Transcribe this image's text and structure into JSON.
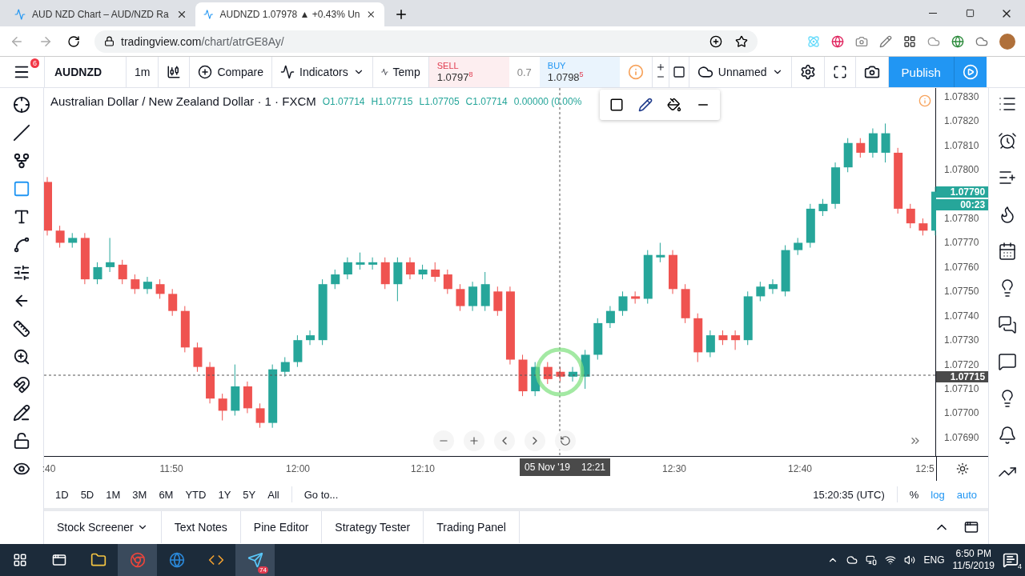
{
  "browser": {
    "tabs": [
      {
        "title": "AUD NZD Chart – AUD/NZD Ra",
        "selected": false
      },
      {
        "title": "AUDNZD 1.07978 ▲ +0.43% Un",
        "selected": true
      }
    ],
    "url": {
      "host": "tradingview.com",
      "path": "/chart/atrGE8Ay/"
    }
  },
  "toolbar": {
    "menu_badge": "6",
    "symbol": "AUDNZD",
    "interval": "1m",
    "compare": "Compare",
    "indicators": "Indicators",
    "templates": "Temp",
    "sell": {
      "label": "SELL",
      "price": "1.0797",
      "pip": "8"
    },
    "spread": "0.7",
    "buy": {
      "label": "BUY",
      "price": "1.0798",
      "pip": "5"
    },
    "layout": "Unnamed",
    "publish": "Publish"
  },
  "left_tools": [
    {
      "selected": false
    },
    {
      "selected": false
    },
    {
      "selected": false
    },
    {
      "selected": true
    },
    {
      "selected": false
    },
    {
      "selected": false
    },
    {
      "selected": false
    },
    {
      "selected": false
    },
    {
      "selected": false
    },
    {
      "selected": false
    },
    {
      "selected": false
    },
    {
      "selected": false
    },
    {
      "selected": false
    },
    {
      "selected": false
    }
  ],
  "legend": {
    "title": "Australian Dollar / New Zealand Dollar · 1 · FXCM",
    "values": [
      "O1.07714",
      "H1.07715",
      "L1.07705",
      "C1.07714",
      "0.00000 (0.00%"
    ]
  },
  "chart": {
    "chart_data": {
      "type": "candlestick",
      "categories": [
        null,
        null,
        null,
        null,
        null,
        null,
        null,
        null,
        null,
        null,
        null,
        null,
        null,
        null,
        null,
        null,
        null,
        null,
        null,
        null,
        null,
        null,
        null,
        null,
        null,
        null,
        null,
        null,
        null,
        null,
        null,
        null,
        null,
        null,
        null,
        null,
        null,
        null,
        null,
        null,
        null,
        null,
        null,
        null,
        null,
        null,
        null,
        null,
        null,
        null,
        null,
        null,
        null,
        null,
        null,
        null,
        null,
        null,
        null,
        null,
        null,
        null,
        null,
        null,
        null,
        null,
        null,
        null,
        null,
        null,
        null,
        null
      ],
      "ylim": [
        1.076824,
        1.078336
      ],
      "yticks": [
        {
          "value": 1.0783,
          "label": "1.07830"
        },
        {
          "value": 1.0782,
          "label": "1.07820"
        },
        {
          "value": 1.0781,
          "label": "1.07810"
        },
        {
          "value": 1.078,
          "label": "1.07800"
        },
        {
          "value": 1.0778,
          "label": "1.07780"
        },
        {
          "value": 1.0777,
          "label": "1.07770"
        },
        {
          "value": 1.0776,
          "label": "1.07760"
        },
        {
          "value": 1.0775,
          "label": "1.07750"
        },
        {
          "value": 1.0774,
          "label": "1.07740"
        },
        {
          "value": 1.0773,
          "label": "1.07730"
        },
        {
          "value": 1.0772,
          "label": "1.07720"
        },
        {
          "value": 1.0771,
          "label": "1.07710"
        },
        {
          "value": 1.077,
          "label": "1.07700"
        },
        {
          "value": 1.0769,
          "label": "1.07690"
        }
      ],
      "ohlc": [
        [
          1.07795,
          1.07797,
          1.07773,
          1.07775
        ],
        [
          1.07775,
          1.07777,
          1.07768,
          1.0777
        ],
        [
          1.0777,
          1.07774,
          1.07768,
          1.07772
        ],
        [
          1.07772,
          1.07774,
          1.07753,
          1.07755
        ],
        [
          1.07755,
          1.07762,
          1.07753,
          1.0776
        ],
        [
          1.0776,
          1.07772,
          1.07758,
          1.07762
        ],
        [
          1.07761,
          1.07763,
          1.07753,
          1.07755
        ],
        [
          1.07755,
          1.07757,
          1.07749,
          1.07751
        ],
        [
          1.07751,
          1.07756,
          1.07749,
          1.07754
        ],
        [
          1.07753,
          1.07755,
          1.07747,
          1.07749
        ],
        [
          1.07749,
          1.07751,
          1.0774,
          1.07742
        ],
        [
          1.07742,
          1.07744,
          1.07725,
          1.07727
        ],
        [
          1.07727,
          1.07729,
          1.07717,
          1.07719
        ],
        [
          1.07719,
          1.07721,
          1.07704,
          1.07706
        ],
        [
          1.07706,
          1.07708,
          1.07697,
          1.07701
        ],
        [
          1.07701,
          1.0772,
          1.07699,
          1.07711
        ],
        [
          1.07711,
          1.07713,
          1.077,
          1.07702
        ],
        [
          1.07702,
          1.07704,
          1.07694,
          1.07696
        ],
        [
          1.07696,
          1.0772,
          1.07694,
          1.07718
        ],
        [
          1.07717,
          1.07723,
          1.07715,
          1.07721
        ],
        [
          1.07721,
          1.07732,
          1.07719,
          1.0773
        ],
        [
          1.0773,
          1.07734,
          1.07728,
          1.07732
        ],
        [
          1.0773,
          1.07755,
          1.07728,
          1.07753
        ],
        [
          1.07753,
          1.07759,
          1.07751,
          1.07757
        ],
        [
          1.07757,
          1.07764,
          1.07755,
          1.07762
        ],
        [
          1.07761,
          1.07766,
          1.07759,
          1.07762
        ],
        [
          1.07761,
          1.07764,
          1.07759,
          1.07762
        ],
        [
          1.07762,
          1.07764,
          1.07751,
          1.07753
        ],
        [
          1.07753,
          1.07764,
          1.07746,
          1.07762
        ],
        [
          1.07762,
          1.07764,
          1.07755,
          1.07757
        ],
        [
          1.07757,
          1.07761,
          1.07755,
          1.07759
        ],
        [
          1.07759,
          1.07762,
          1.07754,
          1.07756
        ],
        [
          1.07757,
          1.07759,
          1.07749,
          1.07751
        ],
        [
          1.07751,
          1.07753,
          1.07742,
          1.07744
        ],
        [
          1.07744,
          1.07754,
          1.07742,
          1.07752
        ],
        [
          1.07744,
          1.07758,
          1.07742,
          1.07753
        ],
        [
          1.0775,
          1.07752,
          1.0774,
          1.07742
        ],
        [
          1.0775,
          1.07752,
          1.0772,
          1.07722
        ],
        [
          1.07722,
          1.07724,
          1.07707,
          1.07709
        ],
        [
          1.07709,
          1.07721,
          1.07707,
          1.07719
        ],
        [
          1.07719,
          1.07721,
          1.07712,
          1.07714
        ],
        [
          1.07717,
          1.07719,
          1.07713,
          1.07715
        ],
        [
          1.07715,
          1.07719,
          1.07713,
          1.07717
        ],
        [
          1.07715,
          1.07726,
          1.0771,
          1.07724
        ],
        [
          1.07724,
          1.07739,
          1.07722,
          1.07737
        ],
        [
          1.07737,
          1.07744,
          1.07735,
          1.07742
        ],
        [
          1.07742,
          1.0775,
          1.0774,
          1.07748
        ],
        [
          1.07748,
          1.0775,
          1.07745,
          1.07747
        ],
        [
          1.07747,
          1.07767,
          1.07745,
          1.07765
        ],
        [
          1.07764,
          1.0777,
          1.07762,
          1.07765
        ],
        [
          1.07765,
          1.07767,
          1.07749,
          1.07751
        ],
        [
          1.07751,
          1.07753,
          1.07737,
          1.07739
        ],
        [
          1.07739,
          1.07741,
          1.07721,
          1.07725
        ],
        [
          1.07725,
          1.07734,
          1.07723,
          1.07732
        ],
        [
          1.07732,
          1.07734,
          1.07728,
          1.0773
        ],
        [
          1.07732,
          1.07734,
          1.07726,
          1.0773
        ],
        [
          1.0773,
          1.0775,
          1.07728,
          1.07748
        ],
        [
          1.07748,
          1.07754,
          1.07746,
          1.07752
        ],
        [
          1.07751,
          1.07755,
          1.07749,
          1.07753
        ],
        [
          1.0775,
          1.07769,
          1.07748,
          1.07767
        ],
        [
          1.07767,
          1.07772,
          1.07765,
          1.0777
        ],
        [
          1.0777,
          1.07786,
          1.07768,
          1.07784
        ],
        [
          1.07783,
          1.07788,
          1.07781,
          1.07786
        ],
        [
          1.07786,
          1.07803,
          1.07784,
          1.07801
        ],
        [
          1.07801,
          1.07813,
          1.07799,
          1.07811
        ],
        [
          1.07811,
          1.07813,
          1.07805,
          1.07807
        ],
        [
          1.07807,
          1.07817,
          1.07805,
          1.07815
        ],
        [
          1.07807,
          1.07819,
          1.07803,
          1.07815
        ],
        [
          1.07807,
          1.07809,
          1.07782,
          1.07784
        ],
        [
          1.07784,
          1.07786,
          1.07776,
          1.07778
        ],
        [
          1.07778,
          1.0778,
          1.07773,
          1.07775
        ],
        [
          1.07775,
          1.07793,
          1.07773,
          1.07791
        ]
      ]
    }
  },
  "price_axis": {
    "last_price": "1.07790",
    "countdown": "00:23",
    "crosshair_price": "1.07715"
  },
  "time_axis": {
    "ticks": [
      ":40",
      "11:50",
      "12:00",
      "12:10",
      "12:30",
      "12:40",
      "12:5"
    ],
    "crosshair_date": "05 Nov '19",
    "crosshair_time": "12:21"
  },
  "range_bar": {
    "ranges": [
      "1D",
      "5D",
      "1M",
      "3M",
      "6M",
      "YTD",
      "1Y",
      "5Y",
      "All"
    ],
    "goto": "Go to...",
    "clock": "15:20:35 (UTC)",
    "percent": "%",
    "log": "log",
    "auto": "auto"
  },
  "bottom_tabs": [
    "Stock Screener",
    "Text Notes",
    "Pine Editor",
    "Strategy Tester",
    "Trading Panel"
  ],
  "taskbar": {
    "telegram_badge": "74",
    "language": "ENG",
    "time": "6:50 PM",
    "date": "11/5/2019",
    "notifications": "4"
  }
}
